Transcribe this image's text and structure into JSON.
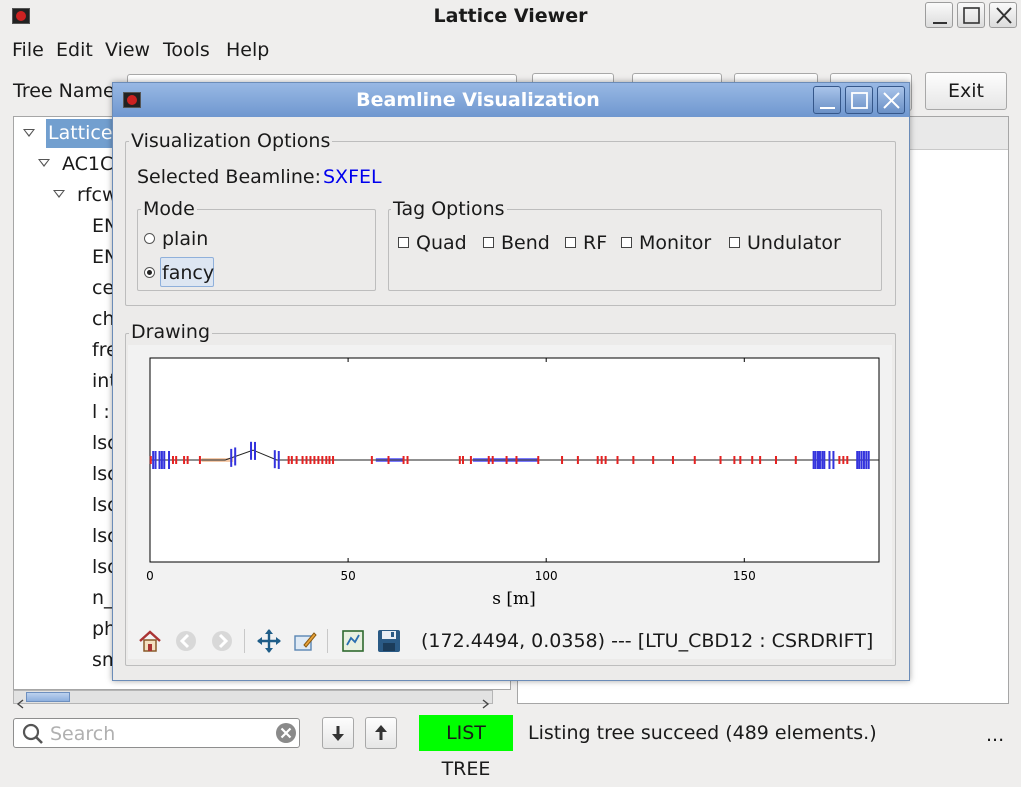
{
  "main_window": {
    "title": "Lattice Viewer",
    "menu": [
      "File",
      "Edit",
      "View",
      "Tools",
      "Help"
    ],
    "tree_name_label": "Tree Name",
    "exit_button": "Exit",
    "tree": {
      "nodes": [
        {
          "label": "Lattice",
          "selected": true,
          "expanded": true
        },
        {
          "label": "AC1C",
          "expanded": true
        },
        {
          "label": "rfcw",
          "expanded": true
        },
        {
          "label": "EN"
        },
        {
          "label": "EN"
        },
        {
          "label": "ce"
        },
        {
          "label": "ch"
        },
        {
          "label": "fre"
        },
        {
          "label": "int"
        },
        {
          "label": "l :"
        },
        {
          "label": "lsc"
        },
        {
          "label": "lsc"
        },
        {
          "label": "lsc"
        },
        {
          "label": "lsc"
        },
        {
          "label": "lsc"
        },
        {
          "label": "n_"
        },
        {
          "label": "ph"
        },
        {
          "label": "sm"
        }
      ]
    },
    "search": {
      "placeholder": "Search"
    },
    "list_tree_badge": "LIST TREE",
    "status_text": "Listing tree succeed (489 elements.)",
    "status_more": "...",
    "colors": {
      "badge": "#00ff00",
      "selection": "#729fcf"
    }
  },
  "dialog": {
    "title": "Beamline Visualization",
    "options_group": "Visualization Options",
    "selected_beamline_label": "Selected Beamline:",
    "selected_beamline_value": "SXFEL",
    "selected_beamline_color": "#0000ee",
    "mode_group": "Mode",
    "modes": [
      {
        "label": "plain",
        "checked": false
      },
      {
        "label": "fancy",
        "checked": true
      }
    ],
    "tag_group": "Tag Options",
    "tags": [
      {
        "label": "Quad",
        "checked": false
      },
      {
        "label": "Bend",
        "checked": false
      },
      {
        "label": "RF",
        "checked": false
      },
      {
        "label": "Monitor",
        "checked": false
      },
      {
        "label": "Undulator",
        "checked": false
      }
    ],
    "drawing_group": "Drawing",
    "toolbar_icons": [
      "home-icon",
      "back-icon",
      "forward-icon",
      "pan-icon",
      "edit-axis-icon",
      "subplots-icon",
      "save-icon"
    ],
    "coord_readout": "(172.4494, 0.0358) --- [LTU_CBD12 : CSRDRIFT]"
  },
  "chart_data": {
    "type": "line",
    "xlabel": "s [m]",
    "ylabel": "",
    "xlim": [
      0,
      184
    ],
    "xticks": [
      0,
      50,
      100,
      150
    ],
    "beamline_baseline": [
      {
        "x": 0,
        "y": 0
      },
      {
        "x": 19,
        "y": 0
      },
      {
        "x": 26,
        "y": 0.09
      },
      {
        "x": 32,
        "y": 0
      },
      {
        "x": 184,
        "y": 0
      }
    ],
    "elements": {
      "quads": [
        0.8,
        1.4,
        2.4,
        3.0,
        3.6,
        4.8,
        20.5,
        21.5,
        25.5,
        26.5,
        31.5,
        32.5,
        167.5,
        168.0,
        168.6,
        169.1,
        169.7,
        170.2,
        171.5,
        172.5,
        178.5,
        179.0,
        179.6,
        180.2,
        180.8,
        181.4
      ],
      "rf_markers": [
        0.2,
        5.8,
        6.6,
        8.6,
        9.5,
        12.6,
        35.0,
        35.8,
        37.0,
        38.5,
        39.5,
        40.5,
        41.5,
        42.5,
        43.5,
        44.5,
        45.3,
        46.2,
        56.0,
        60.2,
        64.0,
        65.0,
        78.2,
        79.0,
        81.0,
        85.5,
        86.5,
        90.0,
        92.5,
        98.0,
        104.0,
        108.0,
        113.0,
        114.0,
        115.0,
        118.0,
        122.0,
        127.0,
        132.0,
        137.5,
        144.0,
        147.5,
        149.0,
        152.0,
        154.0,
        158.0,
        163.0,
        174.0,
        175.0,
        176.0
      ],
      "blue_segments": [
        [
          57,
          64
        ],
        [
          81.5,
          98
        ]
      ],
      "orange_segments": [
        [
          13,
          19
        ],
        [
          19,
          21
        ]
      ]
    }
  }
}
